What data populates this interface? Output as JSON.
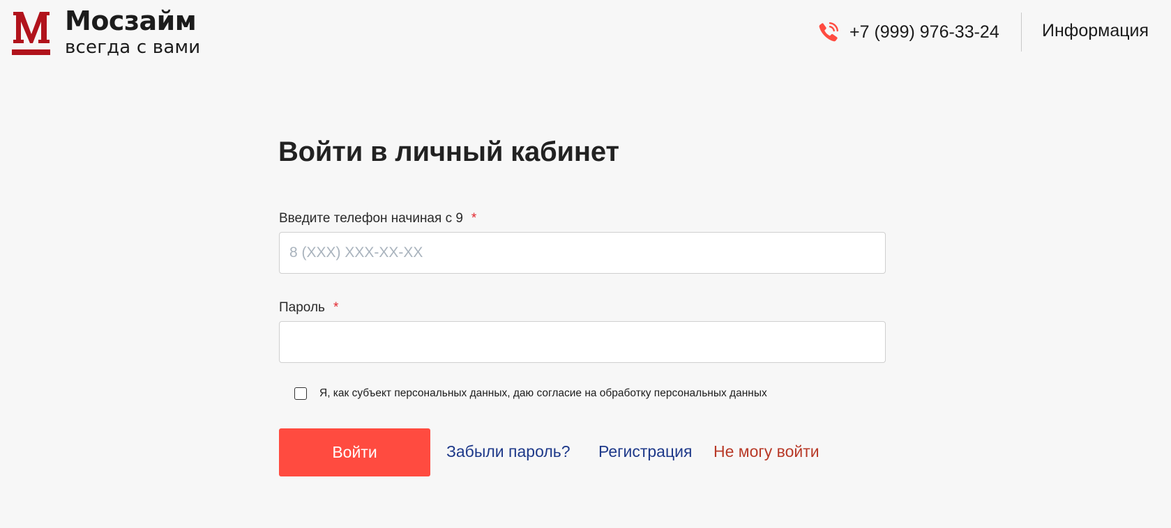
{
  "header": {
    "logo": {
      "name": "Мосзайм",
      "tagline": "всегда с вами",
      "mark_icon": "mosloan-m-logo-icon"
    },
    "phone": {
      "icon": "phone-call-icon",
      "number": "+7 (999) 976-33-24"
    },
    "info_link": "Информация"
  },
  "form": {
    "title": "Войти в личный кабинет",
    "phone_field": {
      "label": "Введите телефон начиная с 9",
      "required_mark": "*",
      "value": "",
      "placeholder": "8 (XXX) XXX-XX-XX"
    },
    "password_field": {
      "label": "Пароль",
      "required_mark": "*",
      "value": "",
      "placeholder": ""
    },
    "consent": {
      "checked": false,
      "text": "Я, как субъект персональных данных, даю согласие на обработку персональных данных"
    },
    "submit_label": "Войти",
    "links": {
      "forgot_password": "Забыли пароль?",
      "register": "Регистрация",
      "cant_login": "Не могу войти"
    }
  },
  "colors": {
    "brand_red": "#b1131c",
    "button_red": "#ff4b40",
    "link_blue": "#1f3a8a",
    "link_red": "#b83a28",
    "required_star": "#e2262e",
    "background": "#f7f7f7"
  }
}
